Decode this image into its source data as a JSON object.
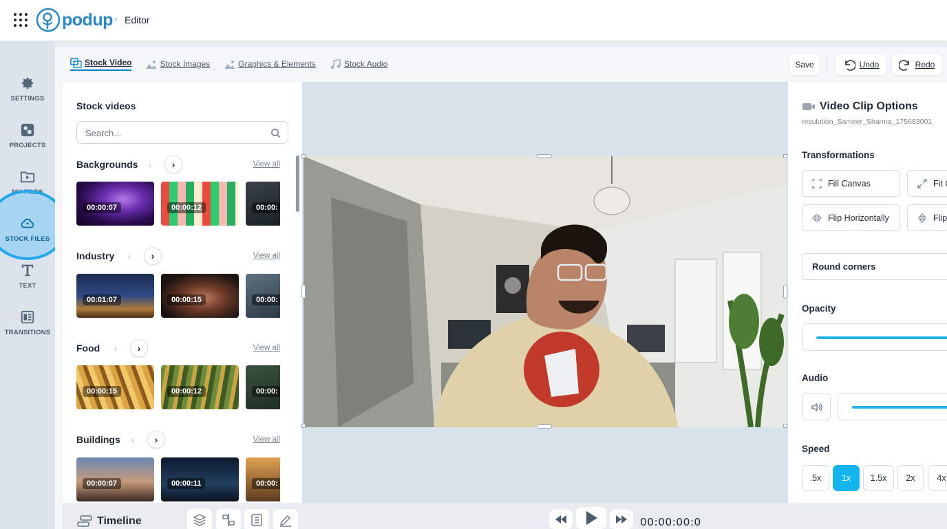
{
  "header": {
    "brand": "podup",
    "breadcrumb_sep": "›",
    "breadcrumb_current": "Editor"
  },
  "rail": {
    "items": [
      {
        "label": "SETTINGS",
        "icon": "gear-icon"
      },
      {
        "label": "PROJECTS",
        "icon": "projects-icon"
      },
      {
        "label": "MY FILES",
        "icon": "files-icon"
      },
      {
        "label": "STOCK FILES",
        "icon": "cloud-icon",
        "active": true
      },
      {
        "label": "TEXT",
        "icon": "text-icon"
      },
      {
        "label": "TRANSITIONS",
        "icon": "transitions-icon"
      }
    ]
  },
  "stock_tabs": [
    {
      "label": "Stock Video",
      "active": true
    },
    {
      "label": "Stock Images"
    },
    {
      "label": "Graphics & Elements"
    },
    {
      "label": "Stock Audio"
    }
  ],
  "toolbar": {
    "save": "Save",
    "undo": "Undo",
    "redo": "Redo"
  },
  "stock_panel": {
    "title": "Stock videos",
    "search_placeholder": "Search...",
    "view_all": "View all",
    "categories": [
      {
        "name": "Backgrounds",
        "durations": [
          "00:00:07",
          "00:00:12",
          "00:00:"
        ]
      },
      {
        "name": "Industry",
        "durations": [
          "00:01:07",
          "00:00:15",
          "00:00:"
        ]
      },
      {
        "name": "Food",
        "durations": [
          "00:00:15",
          "00:00:12",
          "00:00:"
        ]
      },
      {
        "name": "Buildings",
        "durations": [
          "00:00:07",
          "00:00:11",
          "00:00:"
        ]
      }
    ]
  },
  "clip_options": {
    "title": "Video Clip Options",
    "file_name": "resulution_Sameer_Sharma_175683001",
    "transformations_label": "Transformations",
    "fill_canvas": "Fill Canvas",
    "fit_canvas": "Fit C",
    "flip_horizontally": "Flip Horizontally",
    "flip_vertically": "Flip",
    "round_corners": "Round corners",
    "opacity_label": "Opacity",
    "opacity_value": 1.0,
    "audio_label": "Audio",
    "audio_value": 1.0,
    "speed_label": "Speed",
    "speeds": [
      ".5x",
      "1x",
      "1.5x",
      "2x",
      "4x"
    ],
    "active_speed": "1x"
  },
  "timeline": {
    "title": "Timeline",
    "time": "00:00:00:0"
  },
  "colors": {
    "accent": "#13b6ec",
    "brand": "#2b89c8",
    "highlight": "#22a8ea"
  }
}
